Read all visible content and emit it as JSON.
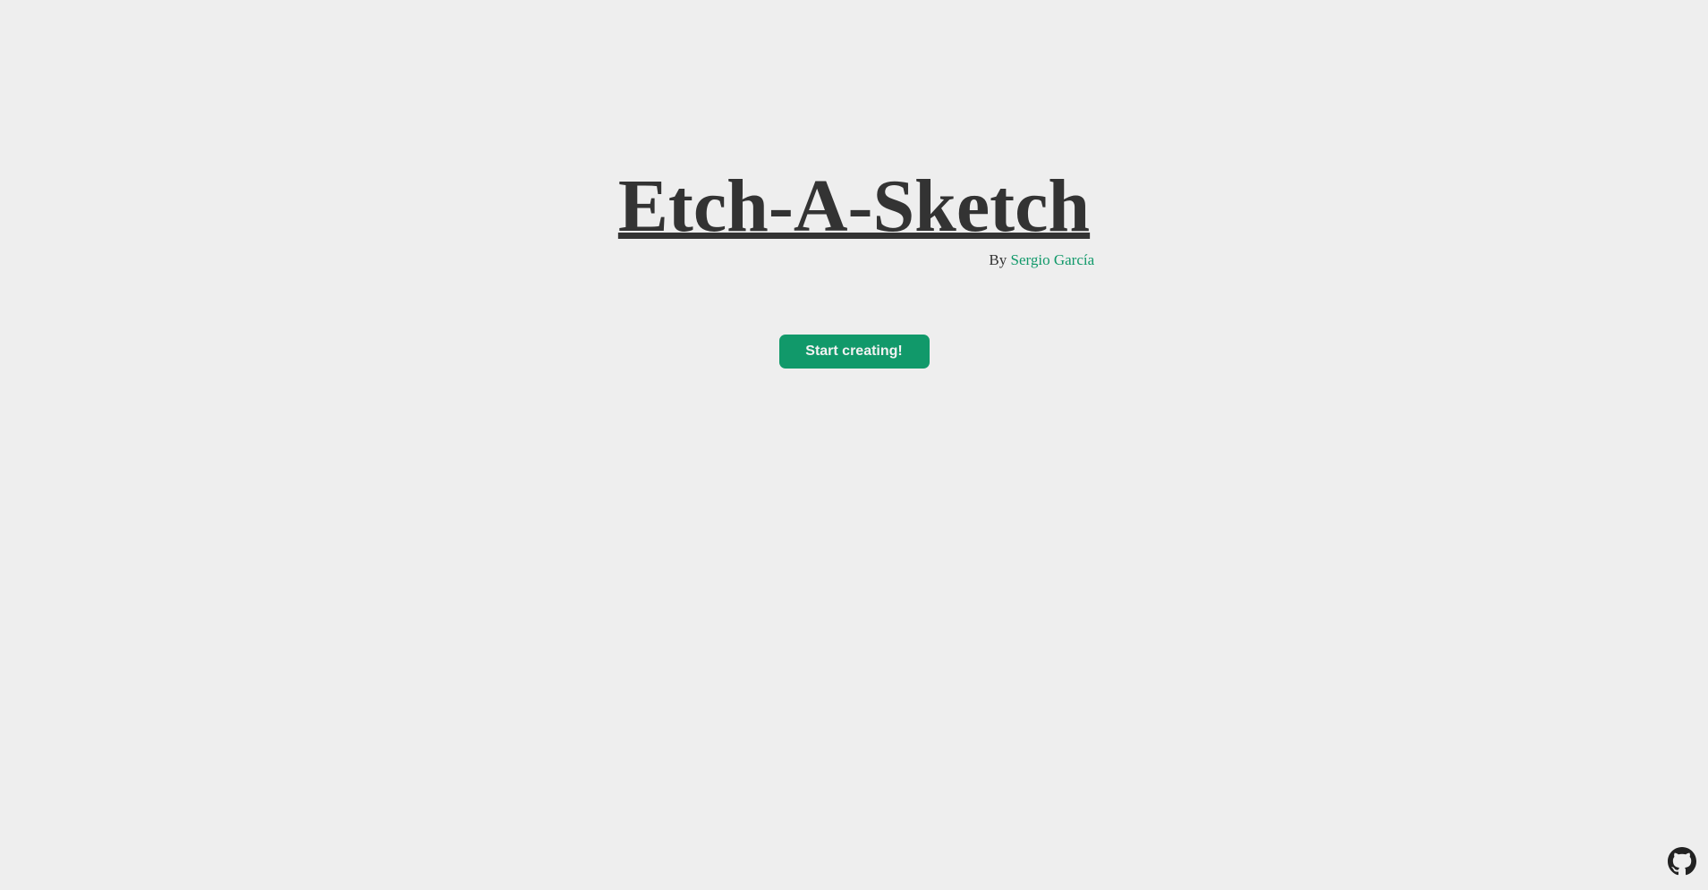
{
  "header": {
    "title": "Etch-A-Sketch",
    "by_label": "By",
    "author": "Sergio García"
  },
  "cta": {
    "label": "Start creating!"
  },
  "footer": {
    "icon": "github-icon"
  },
  "colors": {
    "background": "#eeeeee",
    "text": "#333333",
    "accent": "#11996a",
    "button_text": "#f2f2f2"
  }
}
